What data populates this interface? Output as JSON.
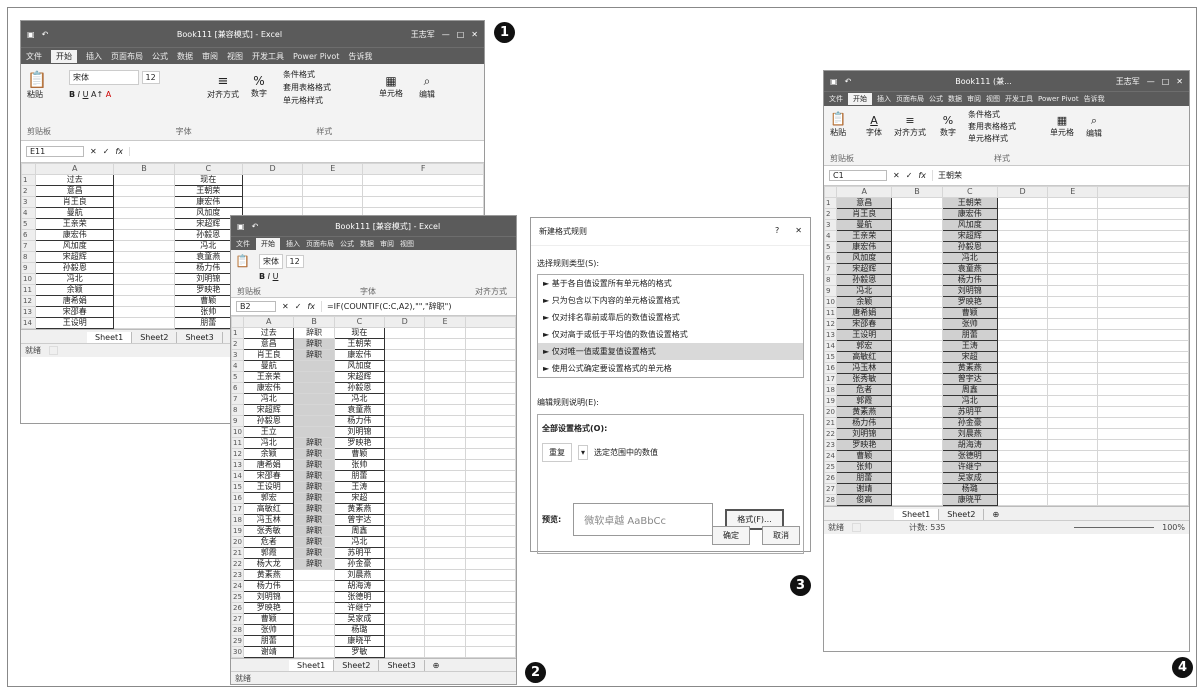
{
  "excel": {
    "title": "Book111 [兼容模式] - Excel",
    "user": "王志军",
    "title_short": "Book111 (兼...",
    "app": "Excel"
  },
  "menu": [
    "文件",
    "开始",
    "插入",
    "页面布局",
    "公式",
    "数据",
    "审阅",
    "视图",
    "开发工具",
    "Power Pivot",
    "告诉我"
  ],
  "ribbon1": {
    "paste": "粘贴",
    "font_name": "宋体",
    "font_size": "12",
    "align": "对齐方式",
    "number": "数字",
    "cond": "条件格式",
    "table": "套用表格格式",
    "cell_style": "单元格样式",
    "cells": "单元格",
    "edit": "编辑",
    "clipboard": "剪贴板",
    "font": "字体",
    "styles": "样式"
  },
  "win1": {
    "name_box": "E11",
    "fx": "fx",
    "cols": [
      "A",
      "B",
      "C",
      "D",
      "E",
      "F"
    ],
    "rows": [
      [
        "过去",
        "",
        "现在"
      ],
      [
        "意昌",
        "",
        "王朝荣"
      ],
      [
        "肖王良",
        "",
        "康宏伟"
      ],
      [
        "曼航",
        "",
        "风加度"
      ],
      [
        "王亲荣",
        "",
        "宋超辉"
      ],
      [
        "康宏伟",
        "",
        "孙毅恩"
      ],
      [
        "风加度",
        "",
        "冯北"
      ],
      [
        "宋超辉",
        "",
        "袁童燕"
      ],
      [
        "孙毅恩",
        "",
        "杨力伟"
      ],
      [
        "冯北",
        "",
        "刘明锦"
      ],
      [
        "余颖",
        "",
        "罗映艳"
      ],
      [
        "唐希娟",
        "",
        "曹颖"
      ],
      [
        "宋邵春",
        "",
        "张帅"
      ],
      [
        "王设明",
        "",
        "朋蕾"
      ]
    ],
    "tabs": [
      "Sheet1",
      "Sheet2",
      "Sheet3"
    ],
    "status": "就绪"
  },
  "win2": {
    "name_box": "B2",
    "formula": "=IF(COUNTIF(C:C,A2),\"\",\"辞职\")",
    "cols": [
      "A",
      "B",
      "C",
      "D",
      "E"
    ],
    "col_a": [
      "过去",
      "意昌",
      "肖王良",
      "曼航",
      "王亲荣",
      "康宏伟",
      "冯北",
      "宋超辉",
      "孙毅恩",
      "王立",
      "冯北",
      "余颖",
      "唐希娟",
      "宋邵春",
      "王设明",
      "郭宏",
      "高敏红",
      "冯玉林",
      "张秀敏",
      "危者",
      "郭霞",
      "杨大龙",
      "黄素燕",
      "杨力伟",
      "刘明锦",
      "罗映艳",
      "曹颖",
      "张帅",
      "朋蕾",
      "谢靖"
    ],
    "col_b": [
      "辞职",
      "辞职",
      "辞职",
      "",
      "",
      "",
      "",
      "",
      "",
      "",
      "辞职",
      "辞职",
      "辞职",
      "辞职",
      "辞职",
      "辞职",
      "辞职",
      "辞职",
      "辞职",
      "辞职",
      "辞职",
      "辞职",
      "",
      "",
      "",
      "",
      "",
      "",
      "",
      ""
    ],
    "col_c": [
      "现在",
      "王朝荣",
      "康宏伟",
      "风加度",
      "宋超辉",
      "孙毅恩",
      "冯北",
      "袁童燕",
      "杨力伟",
      "刘明锦",
      "罗映艳",
      "曹颖",
      "张帅",
      "朋蕾",
      "王涛",
      "宋超",
      "黄素燕",
      "曾宇达",
      "周鑫",
      "冯北",
      "苏明平",
      "孙金豪",
      "刘晨燕",
      "胡海涛",
      "张德明",
      "许继宁",
      "吴家成",
      "杨璐",
      "康晓平",
      "罗敏"
    ],
    "tabs": [
      "Sheet1",
      "Sheet2",
      "Sheet3"
    ],
    "status": "就绪"
  },
  "dialog": {
    "title": "新建格式规则",
    "help": "?",
    "close": "✕",
    "type_label": "选择规则类型(S):",
    "types": [
      "基于各自值设置所有单元格的格式",
      "只为包含以下内容的单元格设置格式",
      "仅对排名靠前或靠后的数值设置格式",
      "仅对高于或低于平均值的数值设置格式",
      "仅对唯一值或重复值设置格式",
      "使用公式确定要设置格式的单元格"
    ],
    "edit_label": "编辑规则说明(E):",
    "all_label": "全部设置格式(O):",
    "dup_value": "重复",
    "dup_text": "选定范围中的数值",
    "preview_label": "预览:",
    "preview_text": "微软卓越 AaBbCc",
    "format_btn": "格式(F)...",
    "ok": "确定",
    "cancel": "取消"
  },
  "win4": {
    "name_box": "C1",
    "formula": "王朝荣",
    "cols": [
      "A",
      "B",
      "C",
      "D",
      "E"
    ],
    "col_a": [
      "意昌",
      "肖王良",
      "曼航",
      "王亲荣",
      "康宏伟",
      "风加度",
      "宋超辉",
      "孙毅恩",
      "冯北",
      "余颖",
      "唐希娟",
      "宋邵春",
      "王设明",
      "郭宏",
      "高敏红",
      "冯玉林",
      "张秀敏",
      "危者",
      "郭霞",
      "黄素燕",
      "杨力伟",
      "刘明锦",
      "罗映艳",
      "曹颖",
      "张帅",
      "朋蕾",
      "谢靖",
      "俊高"
    ],
    "col_c": [
      "王朝荣",
      "康宏伟",
      "风加度",
      "宋超辉",
      "孙毅恩",
      "冯北",
      "袁童燕",
      "杨力伟",
      "刘明锦",
      "罗映艳",
      "曹颖",
      "张帅",
      "朋蕾",
      "王涛",
      "宋超",
      "黄素燕",
      "曾宇达",
      "周鑫",
      "冯北",
      "苏明平",
      "孙金豪",
      "刘晨燕",
      "胡海涛",
      "张德明",
      "许继宁",
      "吴家成",
      "杨璐",
      "康晓平"
    ],
    "tabs": [
      "Sheet1",
      "Sheet2"
    ],
    "status": "就绪",
    "count": "计数: 535",
    "zoom": "100%"
  },
  "callouts": [
    "1",
    "2",
    "3",
    "4"
  ]
}
